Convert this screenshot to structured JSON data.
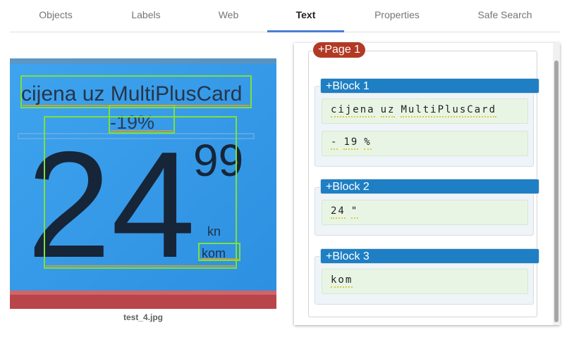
{
  "tabs": [
    {
      "label": "Objects",
      "active": false
    },
    {
      "label": "Labels",
      "active": false
    },
    {
      "label": "Web",
      "active": false
    },
    {
      "label": "Text",
      "active": true
    },
    {
      "label": "Properties",
      "active": false
    },
    {
      "label": "Safe Search",
      "active": false
    }
  ],
  "image": {
    "filename": "test_4.jpg",
    "sign": {
      "top_text": "cijena uz MultiPlusCard",
      "discount": "-19%",
      "price_main": "24",
      "price_cents": "99",
      "currency": "kn",
      "unit": "kom"
    }
  },
  "text_panel": {
    "page_label": "+Page 1",
    "blocks": [
      {
        "label": "+Block 1",
        "lines": [
          [
            "cijena",
            "uz",
            "MultiPlusCard"
          ],
          [
            "-",
            "19",
            "%"
          ]
        ]
      },
      {
        "label": "+Block 2",
        "lines": [
          [
            "24",
            "\""
          ]
        ]
      },
      {
        "label": "+Block 3",
        "lines": [
          [
            "kom"
          ]
        ]
      }
    ]
  },
  "colors": {
    "active_tab_underline": "#4a7fd4",
    "page_pill": "#b23a25",
    "block_pill": "#1e7fc4",
    "word_box": "#7ee03a",
    "symbol_box": "#e8a020"
  }
}
